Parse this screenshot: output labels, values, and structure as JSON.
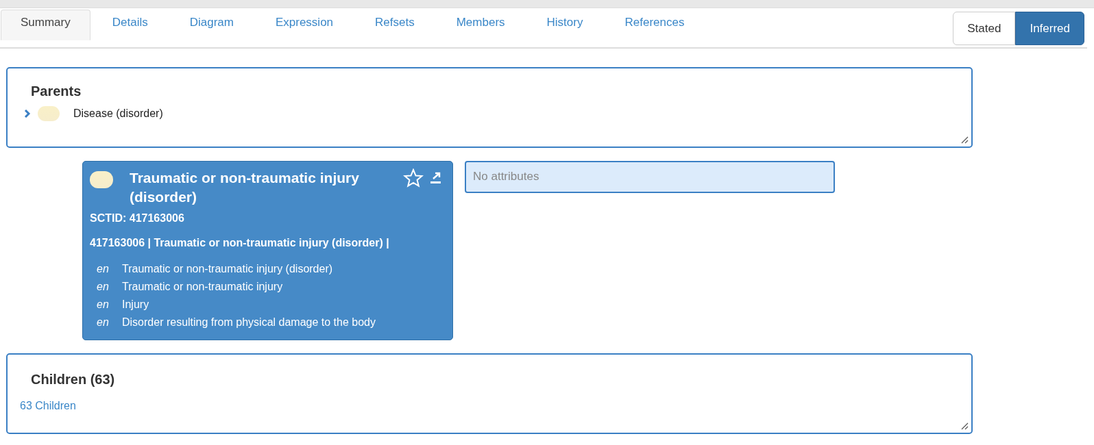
{
  "tabs": [
    {
      "label": "Summary",
      "selected": true
    },
    {
      "label": "Details",
      "selected": false
    },
    {
      "label": "Diagram",
      "selected": false
    },
    {
      "label": "Expression",
      "selected": false
    },
    {
      "label": "Refsets",
      "selected": false
    },
    {
      "label": "Members",
      "selected": false
    },
    {
      "label": "History",
      "selected": false
    },
    {
      "label": "References",
      "selected": false
    }
  ],
  "view_toggle": [
    {
      "label": "Stated",
      "selected": false
    },
    {
      "label": "Inferred",
      "selected": true
    }
  ],
  "parents": {
    "title": "Parents",
    "items": [
      {
        "label": "Disease (disorder)",
        "expanded": false
      }
    ]
  },
  "concept": {
    "title": "Traumatic or non-traumatic injury (disorder)",
    "sctid": "SCTID: 417163006",
    "expression": "417163006 | Traumatic or non-traumatic injury (disorder) |",
    "descriptions": [
      {
        "lang": "en",
        "term": "Traumatic or non-traumatic injury (disorder)"
      },
      {
        "lang": "en",
        "term": "Traumatic or non-traumatic injury"
      },
      {
        "lang": "en",
        "term": "Injury"
      },
      {
        "lang": "en",
        "term": "Disorder resulting from physical damage to the body"
      }
    ]
  },
  "attributes": {
    "text": "No attributes"
  },
  "children": {
    "title": "Children (63)",
    "link": "63 Children"
  }
}
